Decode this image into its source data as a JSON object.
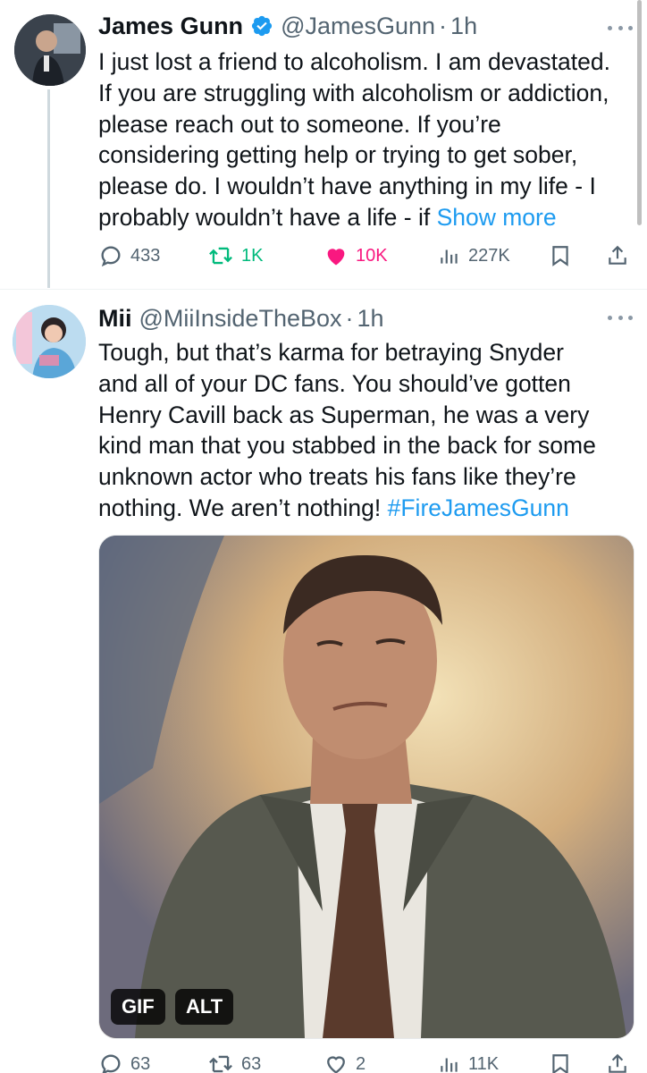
{
  "tweets": [
    {
      "display_name": "James Gunn",
      "verified": true,
      "handle": "@JamesGunn",
      "separator": "·",
      "time": "1h",
      "text_lines": [
        "I just lost a friend to alcoholism. I am devastated.",
        "If you are struggling with alcoholism or addiction,",
        "please reach out to someone. If you’re",
        "considering getting help or trying to get sober,",
        "please do. I wouldn’t have anything in my life - I",
        "probably wouldn’t have a life - if "
      ],
      "show_more": "Show more",
      "stats": {
        "replies": "433",
        "retweets": "1K",
        "likes": "10K",
        "views": "227K"
      },
      "liked": true,
      "retweeted": true
    },
    {
      "display_name": "Mii",
      "handle": "@MiiInsideTheBox",
      "separator": "·",
      "time": "1h",
      "text_lines": [
        "Tough, but that’s karma for betraying Snyder",
        "and all of your DC fans. You should’ve gotten",
        "Henry Cavill back as Superman, he was a very",
        "kind man that you stabbed in the back for some",
        "unknown actor who treats his fans like they’re",
        "nothing. We aren’t nothing! "
      ],
      "hashtag": "#FireJamesGunn",
      "media": {
        "gif_badge": "GIF",
        "alt_badge": "ALT"
      },
      "stats": {
        "replies": "63",
        "retweets": "63",
        "likes": "2",
        "views": "11K"
      }
    }
  ],
  "colors": {
    "accent": "#1d9bf0",
    "retweet_active": "#00ba7c",
    "like_active": "#f91880",
    "secondary_text": "#536471"
  },
  "icons": [
    "verified-badge-icon",
    "more-icon",
    "reply-icon",
    "retweet-icon",
    "like-icon",
    "views-icon",
    "bookmark-icon",
    "share-icon"
  ]
}
